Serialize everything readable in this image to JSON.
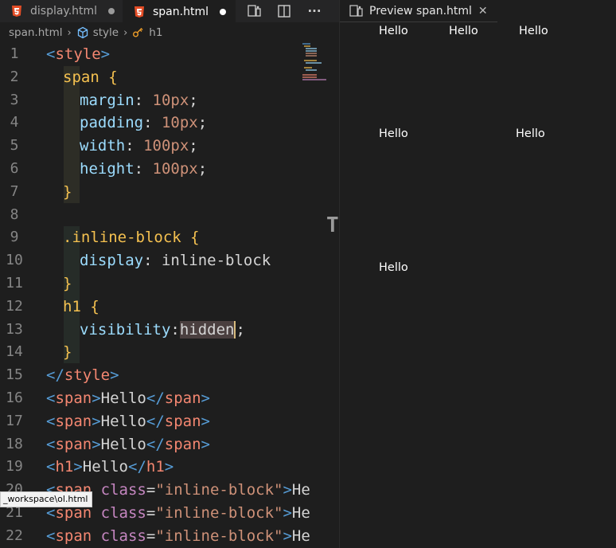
{
  "tabs": [
    {
      "label": "display.html",
      "dirty": true,
      "active": false,
      "icon": "html5-icon"
    },
    {
      "label": "span.html",
      "dirty": true,
      "active": true,
      "icon": "html5-icon"
    }
  ],
  "toolbar": {
    "open_preview_icon": "open-preview-icon",
    "split_editor_icon": "split-editor-icon",
    "more_label": "···"
  },
  "breadcrumb": {
    "file": "span.html",
    "node1": "style",
    "node2": "h1"
  },
  "code_lines": [
    {
      "n": "1"
    },
    {
      "n": "2"
    },
    {
      "n": "3"
    },
    {
      "n": "4"
    },
    {
      "n": "5"
    },
    {
      "n": "6"
    },
    {
      "n": "7"
    },
    {
      "n": "8"
    },
    {
      "n": "9"
    },
    {
      "n": "10"
    },
    {
      "n": "11"
    },
    {
      "n": "12"
    },
    {
      "n": "13"
    },
    {
      "n": "14"
    },
    {
      "n": "15"
    },
    {
      "n": "16"
    },
    {
      "n": "17"
    },
    {
      "n": "18"
    },
    {
      "n": "19"
    },
    {
      "n": "20"
    },
    {
      "n": "21"
    },
    {
      "n": "22"
    }
  ],
  "code": {
    "l1": {
      "open": "<",
      "name": "style",
      "close": ">"
    },
    "l2": {
      "sel": "span",
      "brace": " {"
    },
    "l3": {
      "prop": "margin",
      "colon": ": ",
      "val": "10px",
      "semi": ";"
    },
    "l4": {
      "prop": "padding",
      "colon": ": ",
      "val": "10px",
      "semi": ";"
    },
    "l5": {
      "prop": "width",
      "colon": ": ",
      "val": "100px",
      "semi": ";"
    },
    "l6": {
      "prop": "height",
      "colon": ": ",
      "val": "100px",
      "semi": ";"
    },
    "l7": {
      "brace": "}"
    },
    "l9": {
      "sel": ".inline-block",
      "brace": " {"
    },
    "l10": {
      "prop": "display",
      "colon": ": ",
      "val": "inline-block"
    },
    "l11": {
      "brace": "}"
    },
    "l12": {
      "sel": "h1",
      "brace": " {"
    },
    "l13": {
      "prop": "visibility",
      "colon": ":",
      "val": "hidden",
      "semi": ";"
    },
    "l14": {
      "brace": "}"
    },
    "l15": {
      "open": "</",
      "name": "style",
      "close": ">"
    },
    "l16": {
      "open": "<",
      "name": "span",
      "close": ">",
      "text": "Hello",
      "eopen": "</",
      "ename": "span",
      "eclose": ">"
    },
    "l17": {
      "open": "<",
      "name": "span",
      "close": ">",
      "text": "Hello",
      "eopen": "</",
      "ename": "span",
      "eclose": ">"
    },
    "l18": {
      "open": "<",
      "name": "span",
      "close": ">",
      "text": "Hello",
      "eopen": "</",
      "ename": "span",
      "eclose": ">"
    },
    "l19": {
      "open": "<",
      "name": "h1",
      "close": ">",
      "text": "Hello",
      "eopen": "</",
      "ename": "h1",
      "eclose": ">"
    },
    "l20": {
      "open": "<",
      "name": "span",
      "attr": " class",
      "eq": "=",
      "str": "\"inline-block\"",
      "close": ">",
      "text": "He"
    },
    "l21": {
      "open": "<",
      "name": "span",
      "attr": " class",
      "eq": "=",
      "str": "\"inline-block\"",
      "close": ">",
      "text": "He"
    },
    "l22": {
      "open": "<",
      "name": "span",
      "attr": " class",
      "eq": "=",
      "str": "\"inline-block\"",
      "close": ">",
      "text": "He"
    }
  },
  "tooltip": {
    "text": "_workspace\\ol.html"
  },
  "cursor_glyph": "T",
  "preview": {
    "tab_label": "Preview span.html",
    "close_glyph": "✕",
    "items": [
      "Hello",
      "Hello",
      "Hello",
      "Hello",
      "Hello",
      "Hello"
    ]
  },
  "colors": {
    "background": "#1e1e1e",
    "tabbar": "#252526",
    "tag": "#569cd6",
    "tagname": "#f48771",
    "selector": "#f5c150",
    "property": "#9cdcfe",
    "value": "#ce9178",
    "attr": "#c586c0"
  }
}
